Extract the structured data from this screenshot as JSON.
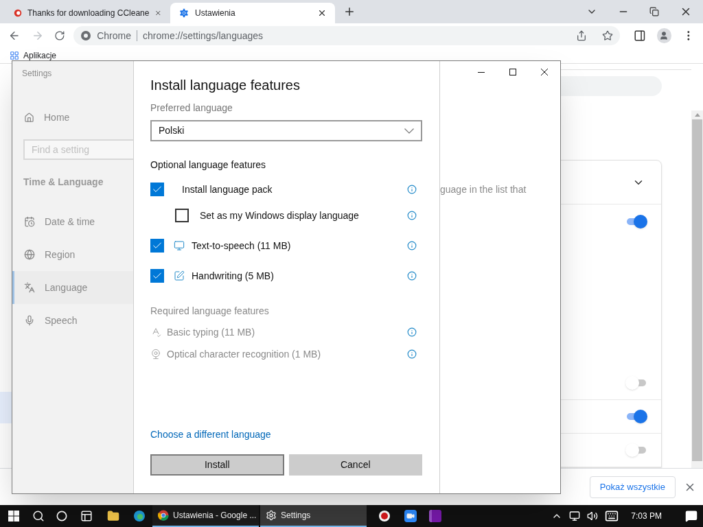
{
  "browser": {
    "tabs": [
      {
        "title": "Thanks for downloading CCleane",
        "selected": false
      },
      {
        "title": "Ustawienia",
        "selected": true
      }
    ],
    "address": {
      "scheme_label": "Chrome",
      "url": "chrome://settings/languages"
    },
    "bookmarks": [
      "Aplikacje"
    ],
    "page": {
      "toggles": [
        {
          "on": true
        },
        {
          "on": false
        },
        {
          "on": true
        },
        {
          "on": false
        }
      ]
    },
    "download_bar": {
      "button": "Pokaż wszystkie"
    }
  },
  "settings_window": {
    "title": "Settings",
    "home": "Home",
    "search": {
      "placeholder": "Find a setting"
    },
    "section": "Time & Language",
    "nav": [
      {
        "label": "Date & time",
        "selected": false
      },
      {
        "label": "Region",
        "selected": false
      },
      {
        "label": "Language",
        "selected": true
      },
      {
        "label": "Speech",
        "selected": false
      }
    ],
    "partial_text": "guage in the list that",
    "dialog": {
      "title": "Install language features",
      "preferred_label": "Preferred language",
      "preferred_value": "Polski",
      "optional": {
        "heading": "Optional language features",
        "items": [
          {
            "label": "Install language pack",
            "checked": true,
            "children": [
              {
                "label": "Set as my Windows display language",
                "checked": false
              }
            ]
          },
          {
            "label": "Text-to-speech (11 MB)",
            "checked": true
          },
          {
            "label": "Handwriting (5 MB)",
            "checked": true
          }
        ]
      },
      "required": {
        "heading": "Required language features",
        "items": [
          "Basic typing (11 MB)",
          "Optical character recognition (1 MB)"
        ]
      },
      "link": "Choose a different language",
      "buttons": [
        {
          "label": "Install",
          "selected": true
        },
        {
          "label": "Cancel",
          "selected": false
        }
      ]
    }
  },
  "taskbar": {
    "apps": [
      {
        "label": "Ustawienia - Google ...",
        "selected": false
      },
      {
        "label": "Settings",
        "selected": true
      }
    ],
    "clock": "7:03 PM"
  }
}
